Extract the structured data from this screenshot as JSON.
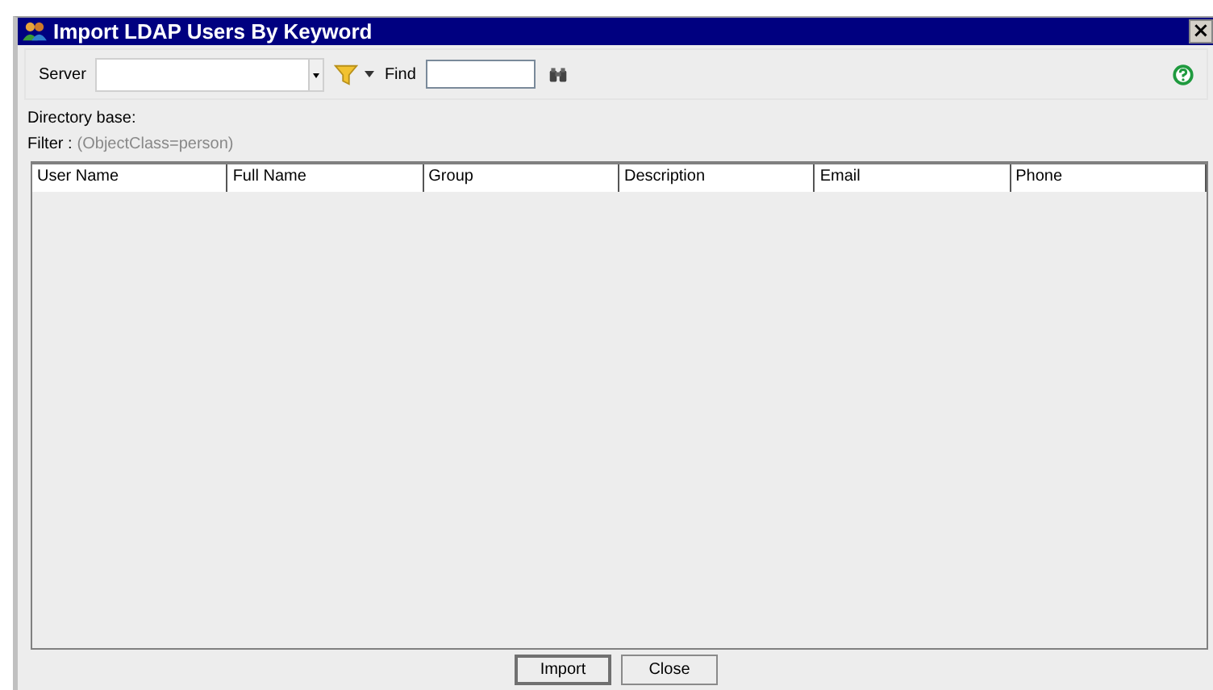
{
  "window": {
    "title": "Import LDAP Users By Keyword",
    "close": "×"
  },
  "toolbar": {
    "server_label": "Server",
    "find_label": "Find"
  },
  "directory_base": "Directory base:",
  "filter": {
    "label": "Filter :",
    "value": "(ObjectClass=person)"
  },
  "table": {
    "columns": [
      "User Name",
      "Full Name",
      "Group",
      "Description",
      "Email",
      "Phone"
    ]
  },
  "buttons": [
    "Import",
    "Close"
  ]
}
